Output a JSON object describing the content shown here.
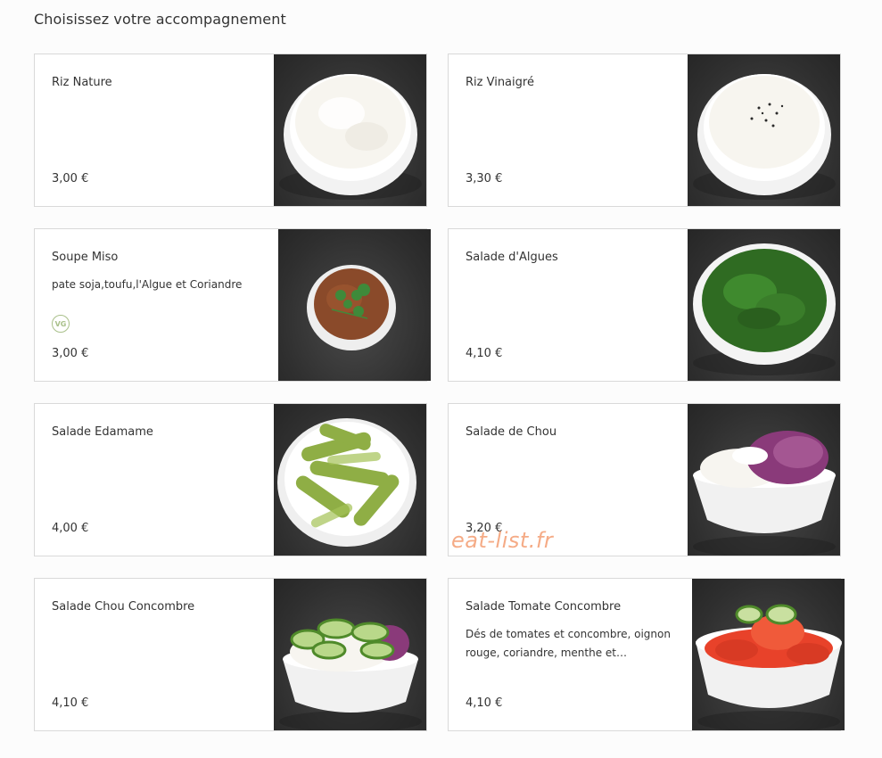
{
  "section_title": "Choisissez votre accompagnement",
  "watermark": "eat-list.fr",
  "items": [
    {
      "name": "Riz Nature",
      "description": "",
      "price": "3,00 €",
      "image": "plain-rice-bowl"
    },
    {
      "name": "Riz Vinaigré",
      "description": "",
      "price": "3,30 €",
      "image": "vinegar-rice-bowl"
    },
    {
      "name": "Soupe Miso",
      "description": "pate soja,toufu,l'Algue et Coriandre",
      "badge": "VG",
      "price": "3,00 €",
      "image": "miso-soup-bowl"
    },
    {
      "name": "Salade d'Algues",
      "description": "",
      "price": "4,10 €",
      "image": "seaweed-salad-bowl"
    },
    {
      "name": "Salade Edamame",
      "description": "",
      "price": "4,00 €",
      "image": "edamame-bowl"
    },
    {
      "name": "Salade de Chou",
      "description": "",
      "price": "3,20 €",
      "image": "cabbage-salad-bowl"
    },
    {
      "name": "Salade Chou Concombre",
      "description": "",
      "price": "4,10 €",
      "image": "cabbage-cucumber-bowl"
    },
    {
      "name": "Salade Tomate Concombre",
      "description": "Dés de tomates et concombre, oignon rouge, coriandre, menthe et…",
      "price": "4,10 €",
      "image": "tomato-cucumber-bowl"
    }
  ]
}
